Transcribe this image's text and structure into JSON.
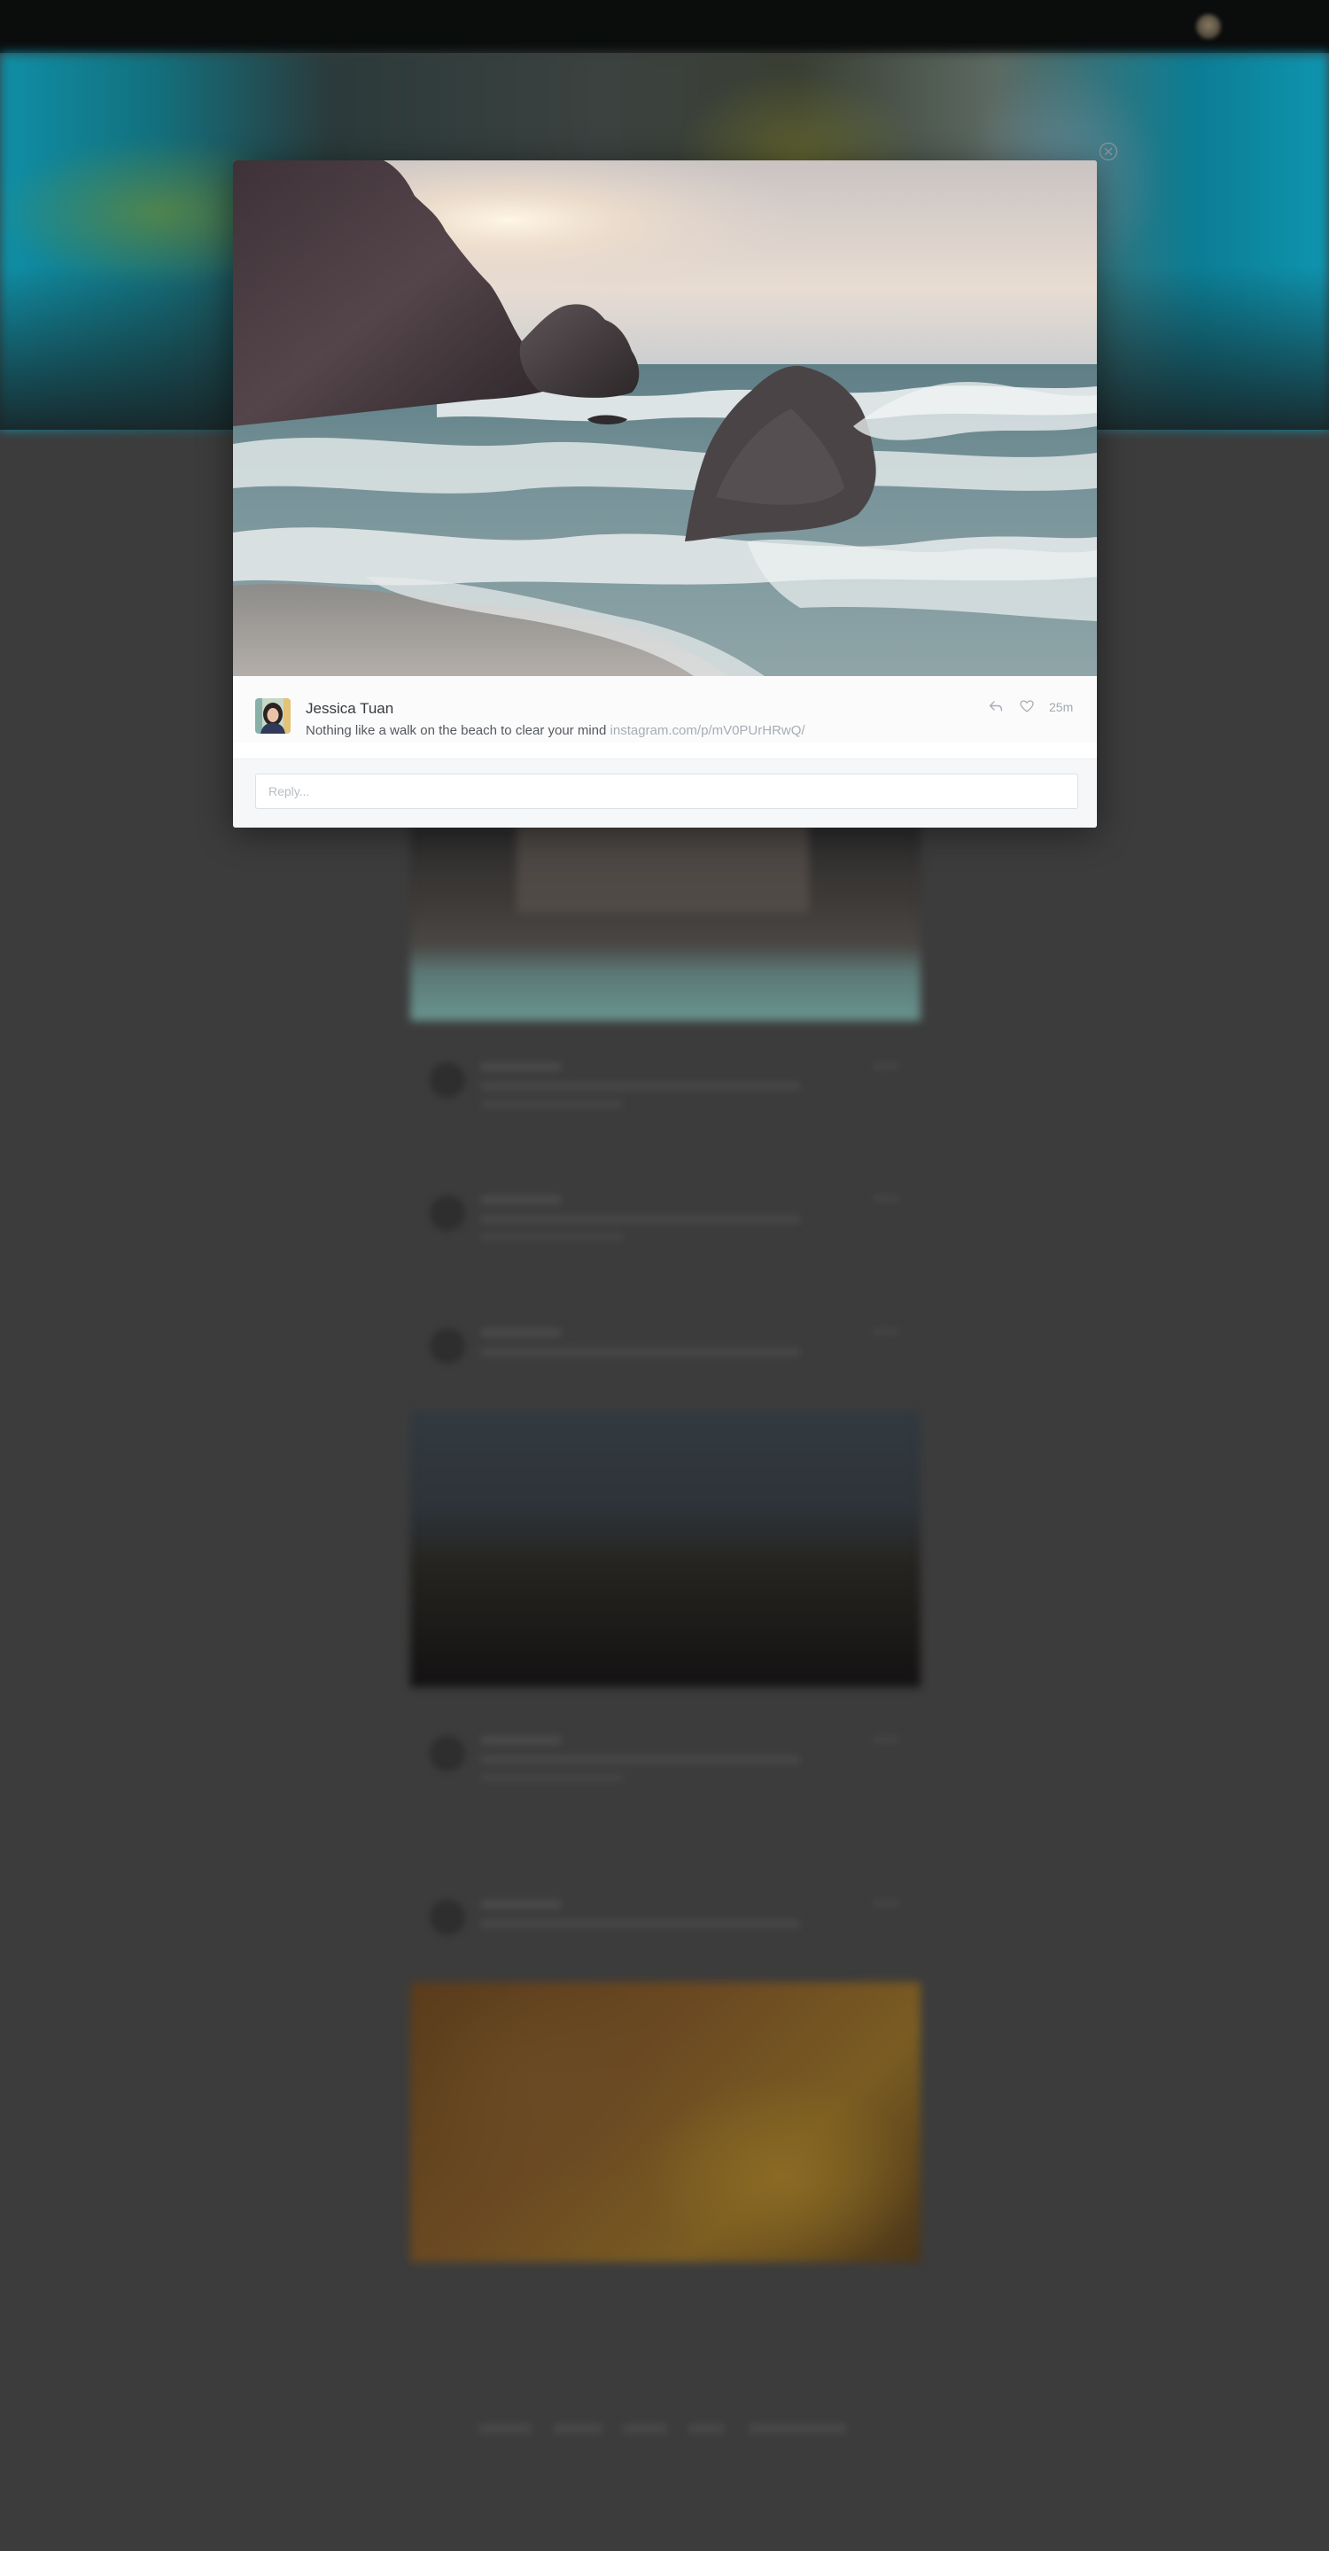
{
  "post": {
    "author": "Jessica Tuan",
    "caption": "Nothing like a walk on the beach to clear your mind",
    "link": "instagram.com/p/mV0PUrHRwQ/",
    "timestamp": "25m"
  },
  "reply": {
    "placeholder": "Reply..."
  },
  "icons": {
    "close": "close-icon",
    "reply": "reply-icon",
    "like": "heart-icon"
  },
  "colors": {
    "overlay": "#3c3c3c",
    "link": "#a7adb4",
    "text": "#363b40"
  }
}
